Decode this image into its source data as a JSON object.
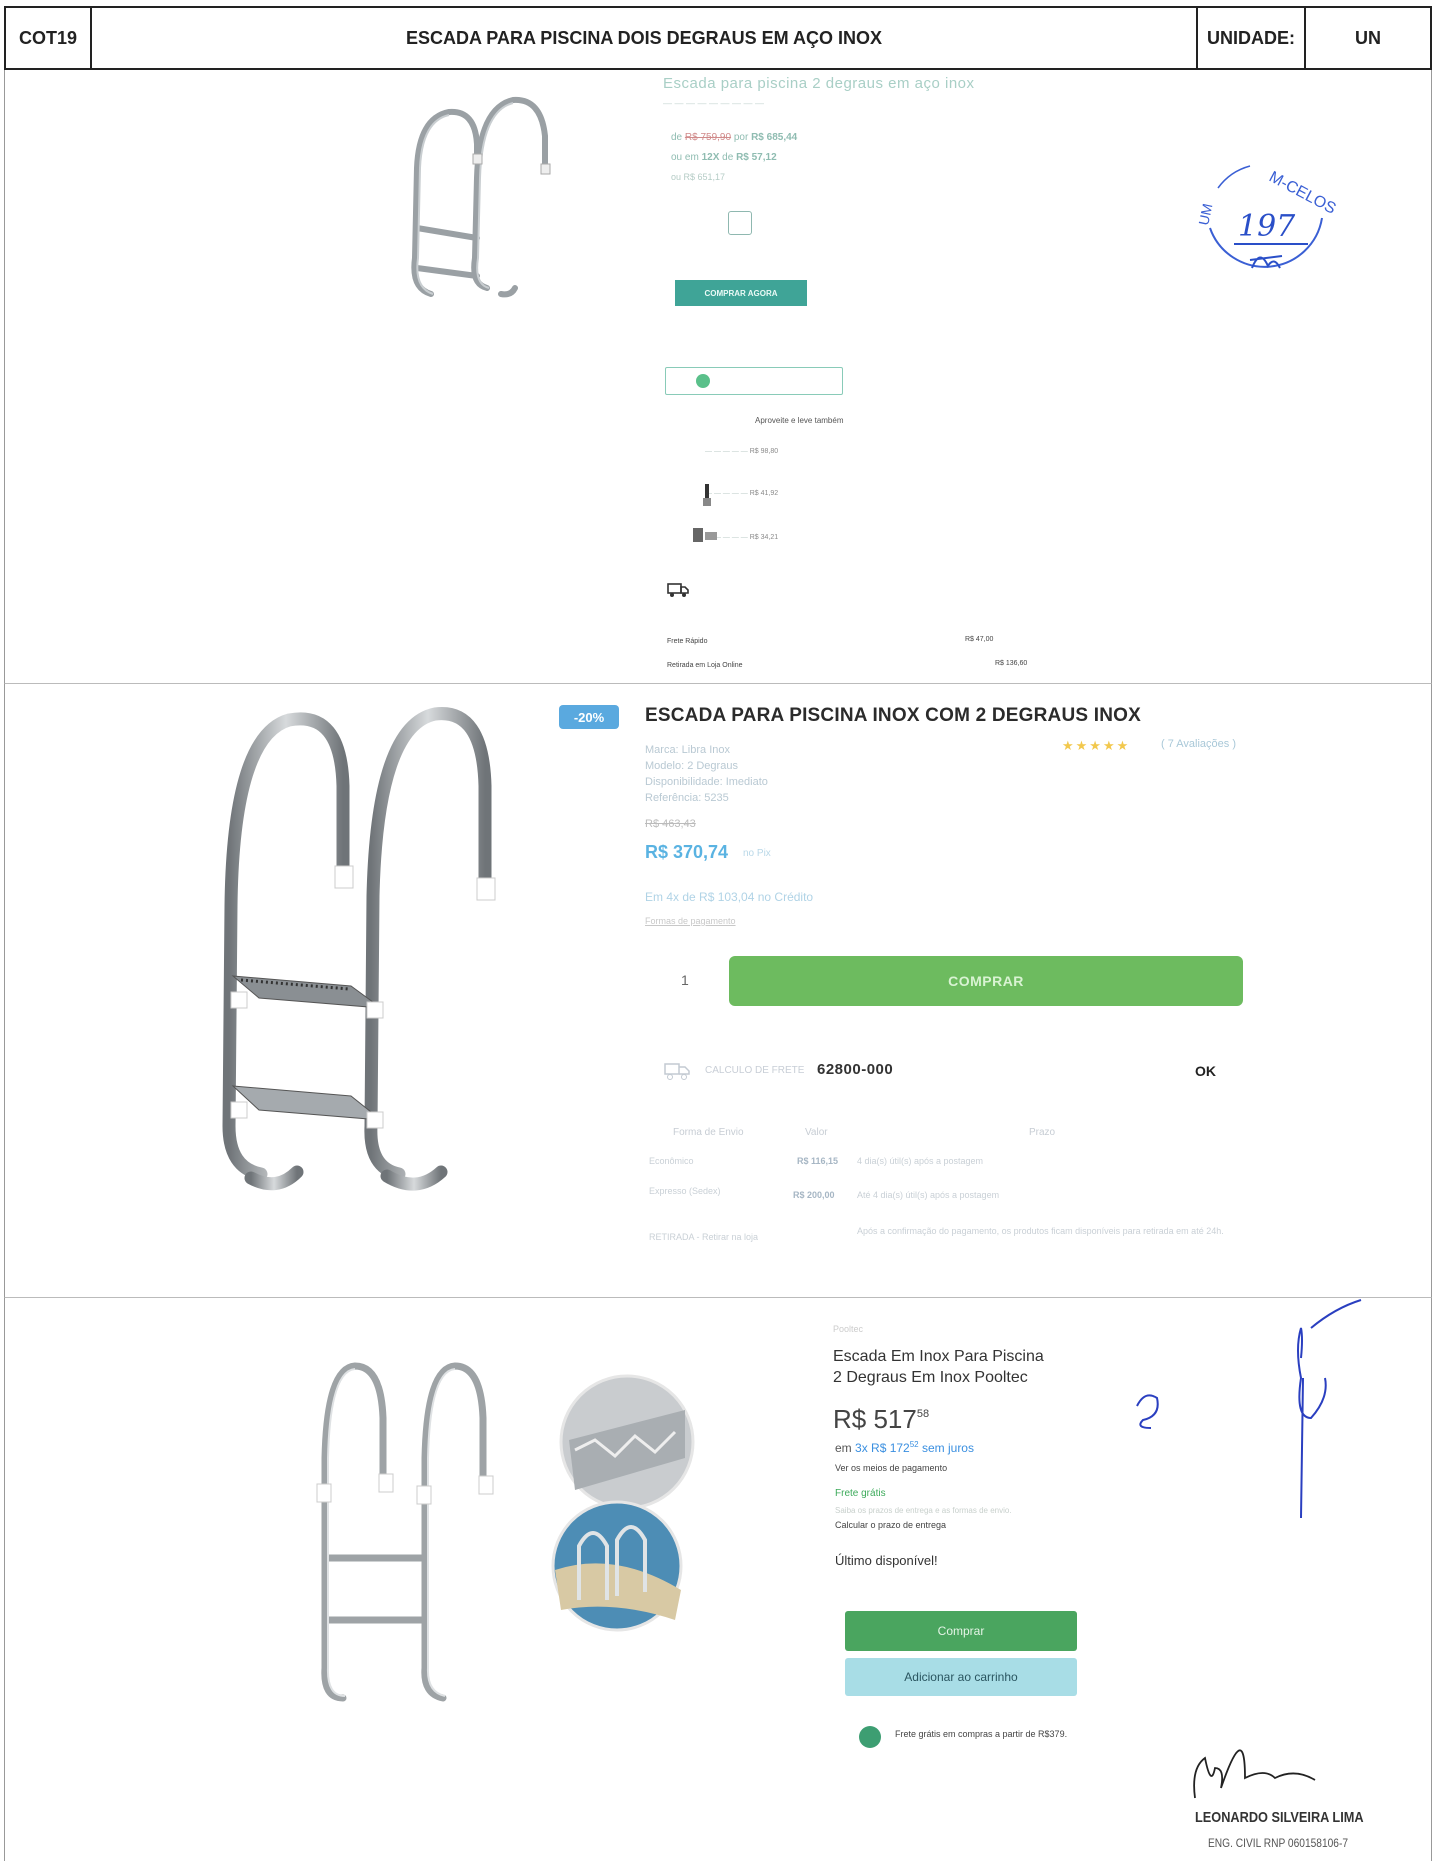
{
  "header": {
    "code": "COT19",
    "title": "ESCADA PARA PISCINA DOIS DEGRAUS EM AÇO INOX",
    "unit_label": "UNIDADE:",
    "unit": "UN"
  },
  "panel1": {
    "title": "Escada para piscina 2 degraus em aço inox",
    "old_price": "R$ 759,90",
    "price": "R$ 685,44",
    "installments": "12X",
    "installment_value": "R$ 57,12",
    "pix_price": "R$ 651,17",
    "buy_now": "COMPRAR AGORA",
    "aproveite": "Aproveite e leve também",
    "rec1_price": "R$ 98,80",
    "rec2_price": "R$ 41,92",
    "rec3_price": "R$ 34,21",
    "shipping1_label": "Frete Rápido",
    "shipping1_price": "R$ 47,00",
    "shipping2_label": "Retirada em Loja Online",
    "shipping2_price": "R$ 136,60"
  },
  "stamp": {
    "text_top": "M-CELOS",
    "text_left": "UM",
    "number": "197",
    "initials": "Ab"
  },
  "panel2": {
    "badge": "-20%",
    "title": "ESCADA PARA PISCINA INOX COM 2 DEGRAUS INOX",
    "specs": [
      "Marca: Libra Inox",
      "Modelo: 2 Degraus",
      "Disponibilidade: Imediato",
      "Referência: 5235"
    ],
    "reviews": "( 7 Avaliações )",
    "old_price": "R$ 463,43",
    "price": "R$ 370,74",
    "pix_note": "no Pix",
    "installments": "Em 4x de R$ 103,04 no Crédito",
    "payment_link": "Formas de pagamento",
    "qty": "1",
    "buy": "COMPRAR",
    "calc_label": "CALCULO DE FRETE",
    "cep": "62800-000",
    "ok": "OK",
    "table_headers": [
      "Forma de Envio",
      "Valor",
      "Prazo"
    ],
    "rows": [
      {
        "forma": "Econômico",
        "valor": "R$ 116,15",
        "prazo": "4 dia(s) útil(s) após a postagem"
      },
      {
        "forma": "Expresso (Sedex)",
        "valor": "R$ 200,00",
        "prazo": "Até 4 dia(s) útil(s) após a postagem"
      },
      {
        "forma": "RETIRADA - Retirar na loja",
        "valor": "",
        "prazo": "Após a confirmação do pagamento, os produtos ficam disponíveis para retirada em até 24h."
      }
    ]
  },
  "panel3": {
    "brand": "Pooltec",
    "title_line1": "Escada Em Inox Para Piscina",
    "title_line2": "2 Degraus Em Inox Pooltec",
    "price_main": "R$ 517",
    "price_cents": "58",
    "inst_em": "em",
    "inst_rest": "3x R$ 172",
    "inst_cents": "52",
    "inst_tail": "sem juros",
    "ver_meios": "Ver os meios de pagamento",
    "frete": "Frete grátis",
    "frete_sub": "Saiba os prazos de entrega e as formas de envio.",
    "calc": "Calcular o prazo de entrega",
    "ultimo": "Último disponível!",
    "buy": "Comprar",
    "cart": "Adicionar ao carrinho",
    "free_text": "Frete grátis em compras a partir de R$379.",
    "signer_name": "LEONARDO SILVEIRA LIMA",
    "signer_reg": "ENG. CIVIL RNP 060158106-7"
  }
}
